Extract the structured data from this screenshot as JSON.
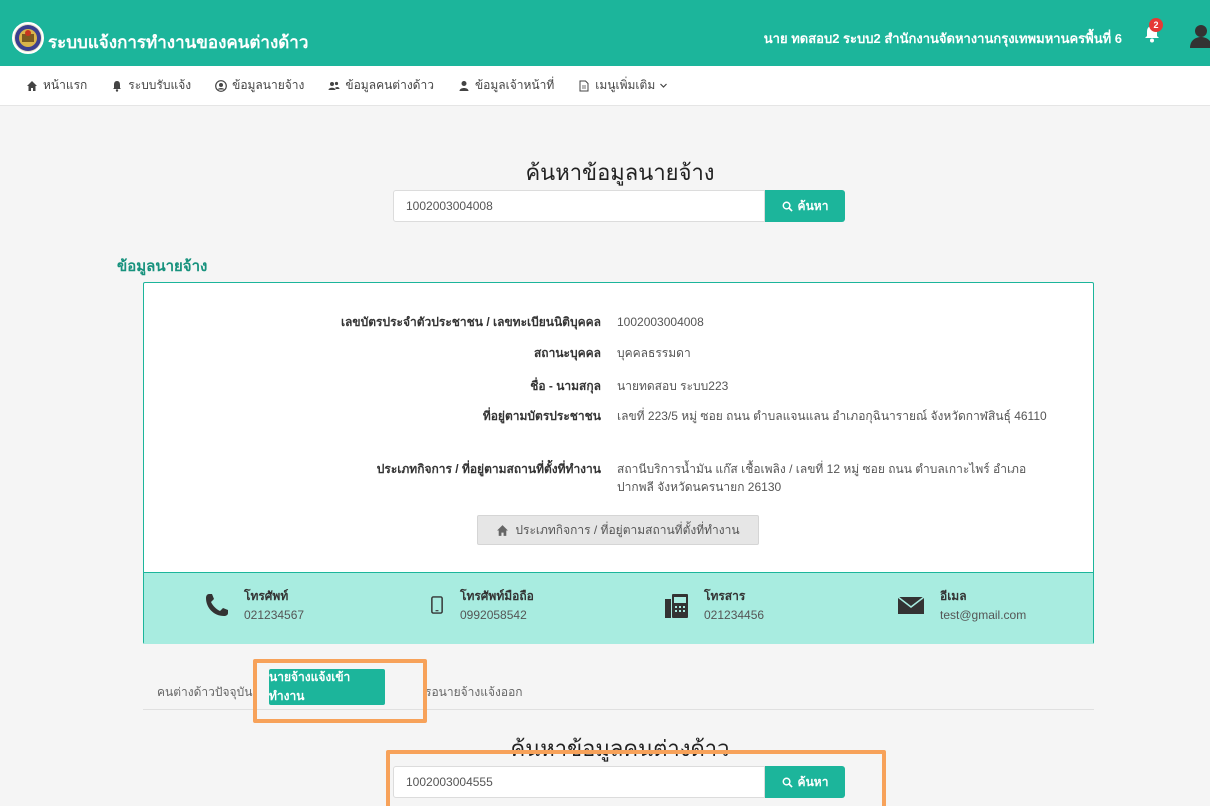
{
  "header": {
    "title": "ระบบแจ้งการทำงานของคนต่างด้าว",
    "user_info": "นาย ทดสอบ2  ระบบ2  สำนักงานจัดหางานกรุงเทพมหานครพื้นที่ 6",
    "notification_count": "2"
  },
  "nav": {
    "items": [
      {
        "label": "หน้าแรก",
        "icon": "home-icon"
      },
      {
        "label": "ระบบรับแจ้ง",
        "icon": "bell-icon"
      },
      {
        "label": "ข้อมูลนายจ้าง",
        "icon": "user-circle-icon"
      },
      {
        "label": "ข้อมูลคนต่างด้าว",
        "icon": "users-icon"
      },
      {
        "label": "ข้อมูลเจ้าหน้าที่",
        "icon": "user-icon"
      },
      {
        "label": "เมนูเพิ่มเติม",
        "icon": "file-icon"
      }
    ]
  },
  "employer_search": {
    "title": "ค้นหาข้อมูลนายจ้าง",
    "value": "1002003004008",
    "button": "ค้นหา"
  },
  "employer": {
    "section_title": "ข้อมูลนายจ้าง",
    "rows": [
      {
        "label": "เลขบัตรประจำตัวประชาชน / เลขทะเบียนนิติบุคคล",
        "value": "1002003004008"
      },
      {
        "label": "สถานะบุคคล",
        "value": "บุคคลธรรมดา"
      },
      {
        "label": "ชื่อ - นามสกุล",
        "value": "นายทดสอบ ระบบ223"
      },
      {
        "label": "ที่อยู่ตามบัตรประชาชน",
        "value": "เลขที่ 223/5 หมู่ ซอย ถนน ตำบลแจนแลน อำเภอกุฉินารายณ์ จังหวัดกาฬสินธุ์ 46110"
      },
      {
        "label": "ประเภทกิจการ / ที่อยู่ตามสถานที่ตั้งที่ทำงาน",
        "value": "สถานีบริการน้ำมัน แก๊ส เชื้อเพลิง / เลขที่ 12 หมู่ ซอย ถนน ตำบลเกาะไพร์ อำเภอปากพลี จังหวัดนครนายก 26130"
      }
    ],
    "business_button": "ประเภทกิจการ / ที่อยู่ตามสถานที่ตั้งที่ทำงาน",
    "contacts": [
      {
        "label": "โทรศัพท์",
        "value": "021234567",
        "icon": "phone-icon"
      },
      {
        "label": "โทรศัพท์มือถือ",
        "value": "0992058542",
        "icon": "mobile-icon"
      },
      {
        "label": "โทรสาร",
        "value": "021234456",
        "icon": "fax-icon"
      },
      {
        "label": "อีเมล",
        "value": "test@gmail.com",
        "icon": "envelope-icon"
      }
    ]
  },
  "tabs": {
    "items": [
      "คนต่างด้าวปัจจุบัน",
      "นายจ้างแจ้งเข้าทำงาน",
      "รอนายจ้างแจ้งออก"
    ],
    "active": "นายจ้างแจ้งเข้าทำงาน"
  },
  "alien_search": {
    "title": "ค้นหาข้อมูลคนต่างด้าว",
    "value": "1002003004555",
    "button": "ค้นหา"
  },
  "colors": {
    "primary": "#1cb59b",
    "contact_bar": "#a8ece0",
    "highlight": "#f7a25a"
  }
}
